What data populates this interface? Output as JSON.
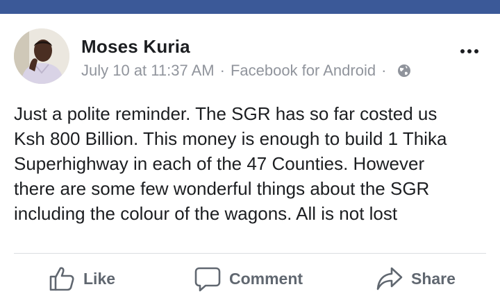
{
  "post": {
    "author": "Moses Kuria",
    "timestamp": "July 10 at 11:37 AM",
    "separator": "·",
    "source": "Facebook for Android",
    "privacy_icon": "globe-icon",
    "more_icon": "more-options-icon",
    "body_lines": [
      "Just a polite reminder. The SGR has so far costed us",
      "Ksh 800 Billion. This money is enough to build 1 Thika",
      "Superhighway in each of the 47 Counties. However",
      "there are some few wonderful things about the SGR",
      "including the colour of the wagons. All is not lost"
    ]
  },
  "actions": {
    "like_label": "Like",
    "comment_label": "Comment",
    "share_label": "Share"
  },
  "colors": {
    "header_bar": "#3b5998",
    "author_text": "#1c1e21",
    "meta_text": "#90949c",
    "action_text": "#606770"
  }
}
